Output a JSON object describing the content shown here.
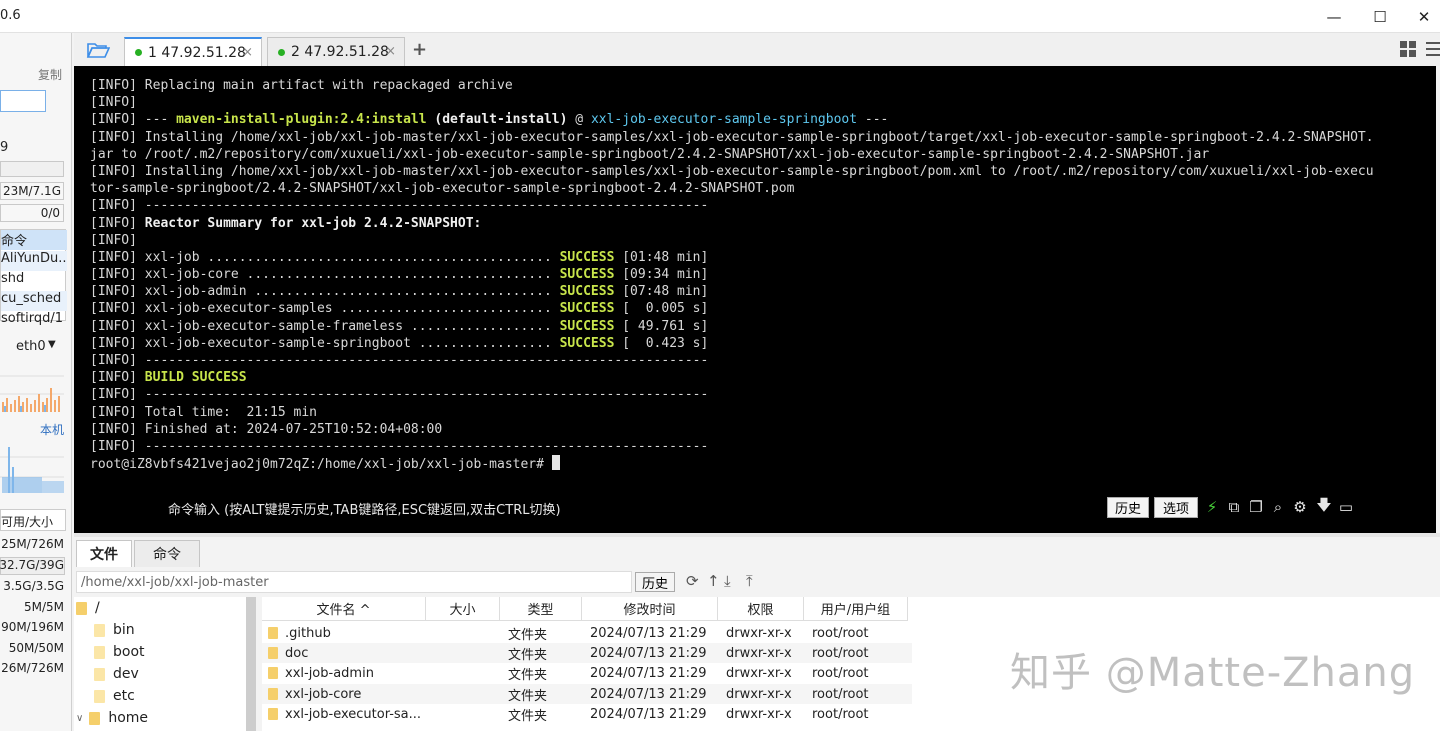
{
  "window": {
    "title": "0.6",
    "minimize": "—",
    "maximize": "☐",
    "close": "✕"
  },
  "left_panel": {
    "copy": "复制",
    "load": "9",
    "memory": "23M/7.1G",
    "swap": "0/0",
    "proc_header": "命令",
    "processes": [
      "AliYunDu...",
      "shd",
      "cu_sched",
      "softirqd/1"
    ],
    "net_iface": "eth0",
    "local": "本机",
    "disk_header": "可用/大小",
    "disks": [
      "25M/726M",
      "32.7G/39G",
      "3.5G/3.5G",
      "5M/5M",
      "90M/196M",
      "50M/50M",
      "26M/726M"
    ]
  },
  "tabs": [
    {
      "label": "1 47.92.51.28",
      "close": "×"
    },
    {
      "label": "2 47.92.51.28",
      "close": "×"
    }
  ],
  "add_tab": "+",
  "terminal": {
    "lines": [
      [
        {
          "t": "[INFO] ",
          "c": "info"
        },
        {
          "t": "Replacing main artifact with repackaged archive",
          "c": "info"
        }
      ],
      [
        {
          "t": "[INFO]",
          "c": "info"
        }
      ],
      [
        {
          "t": "[INFO] ",
          "c": "info"
        },
        {
          "t": "--- ",
          "c": "info"
        },
        {
          "t": "maven-install-plugin:2.4:install",
          "c": "succ"
        },
        {
          "t": " (default-install)",
          "c": "bold"
        },
        {
          "t": " @ ",
          "c": "info"
        },
        {
          "t": "xxl-job-executor-sample-springboot",
          "c": "cyan"
        },
        {
          "t": " ---",
          "c": "info"
        }
      ],
      [
        {
          "t": "[INFO] Installing /home/xxl-job/xxl-job-master/xxl-job-executor-samples/xxl-job-executor-sample-springboot/target/xxl-job-executor-sample-springboot-2.4.2-SNAPSHOT.",
          "c": "info"
        }
      ],
      [
        {
          "t": "jar to /root/.m2/repository/com/xuxueli/xxl-job-executor-sample-springboot/2.4.2-SNAPSHOT/xxl-job-executor-sample-springboot-2.4.2-SNAPSHOT.jar",
          "c": "info"
        }
      ],
      [
        {
          "t": "[INFO] Installing /home/xxl-job/xxl-job-master/xxl-job-executor-samples/xxl-job-executor-sample-springboot/pom.xml to /root/.m2/repository/com/xuxueli/xxl-job-execu",
          "c": "info"
        }
      ],
      [
        {
          "t": "tor-sample-springboot/2.4.2-SNAPSHOT/xxl-job-executor-sample-springboot-2.4.2-SNAPSHOT.pom",
          "c": "info"
        }
      ],
      [
        {
          "t": "[INFO] ------------------------------------------------------------------------",
          "c": "info"
        }
      ],
      [
        {
          "t": "[INFO] ",
          "c": "info"
        },
        {
          "t": "Reactor Summary for xxl-job 2.4.2-SNAPSHOT:",
          "c": "bold"
        }
      ],
      [
        {
          "t": "[INFO]",
          "c": "info"
        }
      ],
      [
        {
          "t": "[INFO] xxl-job ............................................ ",
          "c": "info"
        },
        {
          "t": "SUCCESS",
          "c": "succ"
        },
        {
          "t": " [01:48 min]",
          "c": "info"
        }
      ],
      [
        {
          "t": "[INFO] xxl-job-core ....................................... ",
          "c": "info"
        },
        {
          "t": "SUCCESS",
          "c": "succ"
        },
        {
          "t": " [09:34 min]",
          "c": "info"
        }
      ],
      [
        {
          "t": "[INFO] xxl-job-admin ...................................... ",
          "c": "info"
        },
        {
          "t": "SUCCESS",
          "c": "succ"
        },
        {
          "t": " [07:48 min]",
          "c": "info"
        }
      ],
      [
        {
          "t": "[INFO] xxl-job-executor-samples ........................... ",
          "c": "info"
        },
        {
          "t": "SUCCESS",
          "c": "succ"
        },
        {
          "t": " [  0.005 s]",
          "c": "info"
        }
      ],
      [
        {
          "t": "[INFO] xxl-job-executor-sample-frameless .................. ",
          "c": "info"
        },
        {
          "t": "SUCCESS",
          "c": "succ"
        },
        {
          "t": " [ 49.761 s]",
          "c": "info"
        }
      ],
      [
        {
          "t": "[INFO] xxl-job-executor-sample-springboot ................. ",
          "c": "info"
        },
        {
          "t": "SUCCESS",
          "c": "succ"
        },
        {
          "t": " [  0.423 s]",
          "c": "info"
        }
      ],
      [
        {
          "t": "[INFO] ------------------------------------------------------------------------",
          "c": "info"
        }
      ],
      [
        {
          "t": "[INFO] ",
          "c": "info"
        },
        {
          "t": "BUILD SUCCESS",
          "c": "succ"
        }
      ],
      [
        {
          "t": "[INFO] ------------------------------------------------------------------------",
          "c": "info"
        }
      ],
      [
        {
          "t": "[INFO] Total time:  21:15 min",
          "c": "info"
        }
      ],
      [
        {
          "t": "[INFO] Finished at: 2024-07-25T10:52:04+08:00",
          "c": "info"
        }
      ],
      [
        {
          "t": "[INFO] ------------------------------------------------------------------------",
          "c": "info"
        }
      ]
    ],
    "prompt": "root@iZ8vbfs421vejao2j0m72qZ:/home/xxl-job/xxl-job-master# "
  },
  "cmdbar": {
    "hint": "命令输入 (按ALT键提示历史,TAB键路径,ESC键返回,双击CTRL切换)",
    "history": "历史",
    "options": "选项"
  },
  "file_panel": {
    "tabs": [
      "文件",
      "命令"
    ],
    "path": "/home/xxl-job/xxl-job-master",
    "history": "历史",
    "tree": [
      {
        "label": "/",
        "indent": 0
      },
      {
        "label": "bin",
        "indent": 1
      },
      {
        "label": "boot",
        "indent": 1
      },
      {
        "label": "dev",
        "indent": 1
      },
      {
        "label": "etc",
        "indent": 1
      },
      {
        "label": "home",
        "indent": 1
      }
    ],
    "headers": [
      "文件名 ^",
      "大小",
      "类型",
      "修改时间",
      "权限",
      "用户/用户组"
    ],
    "files": [
      [
        ".github",
        "",
        "文件夹",
        "2024/07/13 21:29",
        "drwxr-xr-x",
        "root/root"
      ],
      [
        "doc",
        "",
        "文件夹",
        "2024/07/13 21:29",
        "drwxr-xr-x",
        "root/root"
      ],
      [
        "xxl-job-admin",
        "",
        "文件夹",
        "2024/07/13 21:29",
        "drwxr-xr-x",
        "root/root"
      ],
      [
        "xxl-job-core",
        "",
        "文件夹",
        "2024/07/13 21:29",
        "drwxr-xr-x",
        "root/root"
      ],
      [
        "xxl-job-executor-sa...",
        "",
        "文件夹",
        "2024/07/13 21:29",
        "drwxr-xr-x",
        "root/root"
      ]
    ]
  },
  "watermark": "知乎 @Matte-Zhang"
}
